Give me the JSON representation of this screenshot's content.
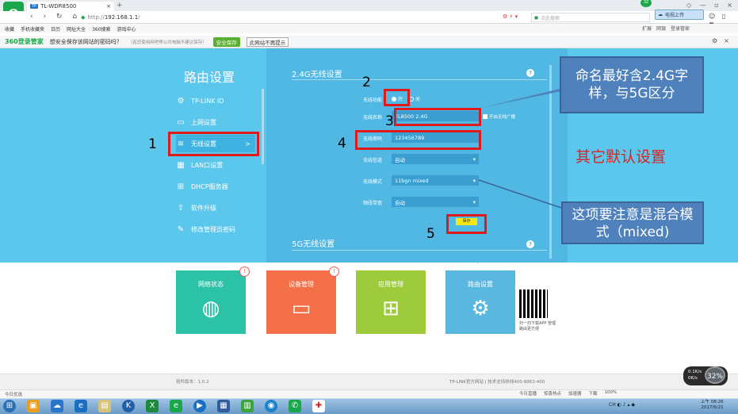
{
  "browser": {
    "tab_title": "TL-WDR8500",
    "tab_logo": "TP",
    "new_tab": "+",
    "url_prefix": "http://",
    "url_host": "192.168.1.1",
    "url_suffix": "/",
    "search_placeholder": "点此搜索",
    "cloud_button": "电视上传",
    "badge_count": "32",
    "bookmarks": [
      "收藏",
      "手机收藏夹",
      "日历",
      "网址大全",
      "360搜索",
      "游戏中心"
    ],
    "bookmark_right": [
      "扩展",
      "网银",
      "登录管家"
    ],
    "save_bar": {
      "brand": "360登录管家",
      "question": "想安全保存该网站的密码吗？",
      "hint": "（若您使用网吧等公共电脑不建议保存）",
      "safe_save": "安全保存",
      "never": "此网站不再提示"
    }
  },
  "sidebar": {
    "title": "路由设置",
    "items": [
      {
        "label": "TP-LINK ID",
        "icon": "gear-icon"
      },
      {
        "label": "上网设置",
        "icon": "monitor-icon"
      },
      {
        "label": "无线设置",
        "icon": "wifi-icon"
      },
      {
        "label": "LAN口设置",
        "icon": "lan-icon"
      },
      {
        "label": "DHCP服务器",
        "icon": "dhcp-icon"
      },
      {
        "label": "软件升级",
        "icon": "upgrade-icon"
      },
      {
        "label": "修改管理员密码",
        "icon": "pencil-icon"
      }
    ],
    "active_chevron": ">"
  },
  "wireless24": {
    "section_title": "2.4G无线设置",
    "help": "?",
    "enable_label": "无线功能",
    "enable_on": "开",
    "enable_off": "关",
    "ssid_label": "无线名称",
    "ssid_value": "TL8500 2.4G",
    "hide_ssid": "开启无线广播",
    "password_label": "无线密码",
    "password_value": "123456789",
    "channel_label": "无线信道",
    "channel_value": "自动",
    "mode_label": "无线模式",
    "mode_value": "11bgn mixed",
    "bandwidth_label": "频段带宽",
    "bandwidth_value": "自动",
    "save": "保存"
  },
  "wireless5": {
    "section_title": "5G无线设置",
    "help": "?"
  },
  "annotations": {
    "n1": "1",
    "n2": "2",
    "n3": "3",
    "n4": "4",
    "n5": "5",
    "callout_ssid": "命名最好含2.4G字样，与5G区分",
    "callout_mode": "这项要注意是混合模式（mixed)",
    "other_default": "其它默认设置"
  },
  "tiles": [
    {
      "label": "网络状态",
      "badge": "!",
      "color": "#2cc2a8"
    },
    {
      "label": "设备管理",
      "badge": "!",
      "color": "#f37048"
    },
    {
      "label": "应用管理",
      "badge": "",
      "color": "#9dcb3b"
    },
    {
      "label": "路由设置",
      "badge": "",
      "color": "#5ab8e0"
    }
  ],
  "qr_text": "扫一扫下载APP 管理路由更方便",
  "footer": {
    "version": "软件版本：1.0.2",
    "support": "TP-LINK官方网站  |  技术支持热线400-8863-400"
  },
  "speed": {
    "up": "0.1K/s",
    "down": "0K/s",
    "percent": "32%"
  },
  "statusbar": {
    "left": "今日优选",
    "right": [
      "今日直播",
      "惊喜热点",
      "加速器",
      "下载",
      "100%"
    ]
  },
  "taskbar": {
    "lang": "CH",
    "time": "上午 08:26",
    "date": "2017/6/21"
  }
}
